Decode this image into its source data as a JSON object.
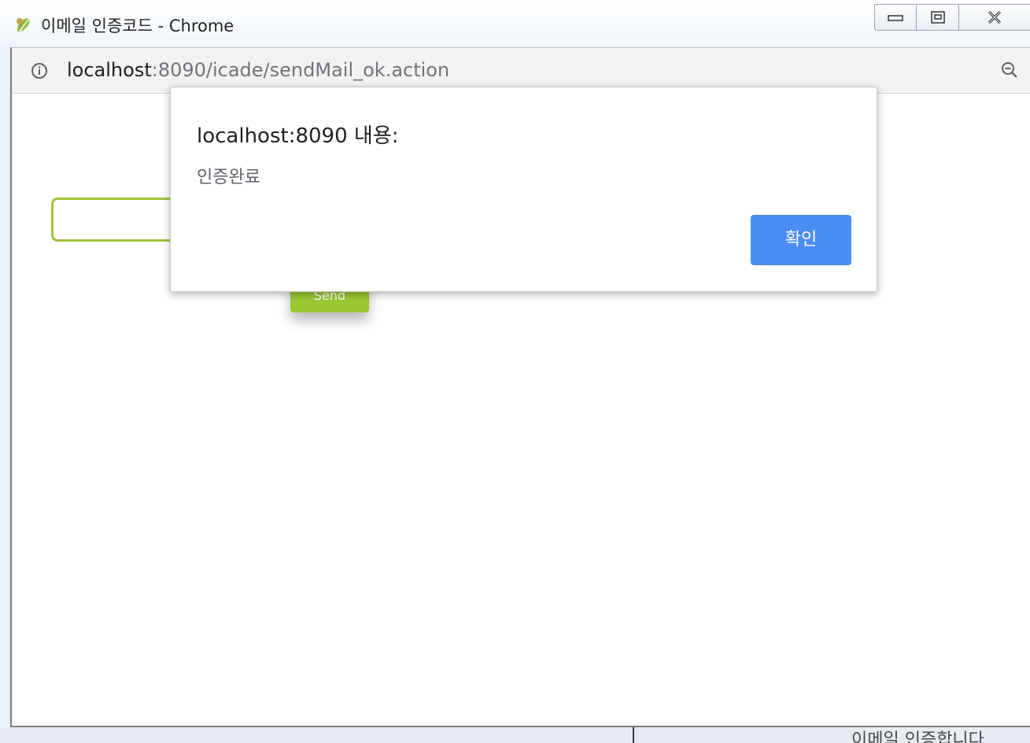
{
  "window": {
    "title": "이메일 인증코드 - Chrome",
    "app_icon": "chrome-app-icon",
    "controls": {
      "minimize_icon": "minimize-icon",
      "restore_icon": "restore-icon",
      "close_icon": "close-icon"
    }
  },
  "addressbar": {
    "info_icon": "info-icon",
    "url_host": "localhost",
    "url_rest": ":8090/icade/sendMail_ok.action",
    "zoom_icon": "zoom-out-icon"
  },
  "page": {
    "input_value": "",
    "button_label": "Send"
  },
  "dialog": {
    "title": "localhost:8090 내용:",
    "message": "인증완료",
    "ok_label": "확인"
  },
  "background_window": {
    "partial_text": "이메일 인증합니다"
  },
  "colors": {
    "dialog_button": "#4a8ef4",
    "page_accent": "#9bc832"
  }
}
